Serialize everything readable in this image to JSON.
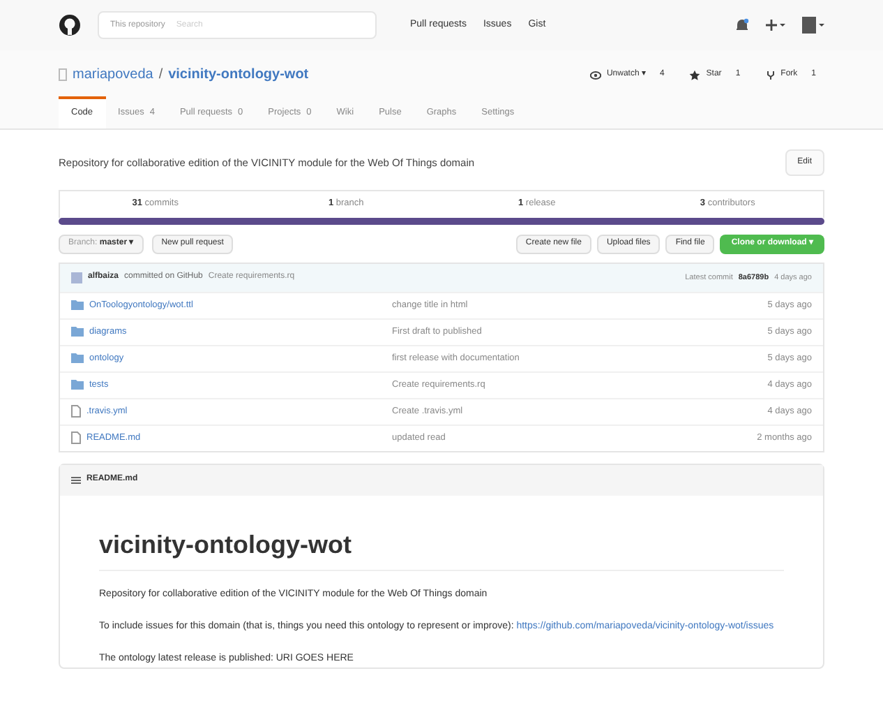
{
  "header": {
    "scope": "This repository",
    "search_placeholder": "Search",
    "nav": [
      "Pull requests",
      "Issues",
      "Gist"
    ]
  },
  "repo": {
    "owner": "mariapoveda",
    "separator": "/",
    "name": "vicinity-ontology-wot",
    "actions": [
      {
        "label": "Unwatch ▾",
        "count": "4",
        "kind": "watch"
      },
      {
        "label": "Star",
        "count": "1",
        "kind": "star"
      },
      {
        "label": "Fork",
        "count": "1",
        "kind": "fork"
      }
    ]
  },
  "tabs": [
    {
      "label": "Code",
      "selected": true
    },
    {
      "label": "Issues",
      "count": "4",
      "selected": false
    },
    {
      "label": "Pull requests",
      "count": "0",
      "selected": false
    },
    {
      "label": "Projects",
      "count": "0",
      "selected": false
    },
    {
      "label": "Wiki",
      "selected": false
    },
    {
      "label": "Pulse",
      "selected": false
    },
    {
      "label": "Graphs",
      "selected": false
    },
    {
      "label": "Settings",
      "selected": false
    }
  ],
  "description": "Repository for collaborative edition of the VICINITY module for the Web Of Things domain",
  "edit_button": "Edit",
  "stats": [
    {
      "number": "31",
      "label": "commits"
    },
    {
      "number": "1",
      "label": "branch"
    },
    {
      "number": "1",
      "label": "release"
    },
    {
      "number": "3",
      "label": "contributors"
    }
  ],
  "toolbar": {
    "branch_label": "Branch:",
    "branch": "master ▾",
    "new_pr": "New pull request",
    "buttons": [
      "Create new file",
      "Upload files",
      "Find file"
    ],
    "clone": "Clone or download ▾"
  },
  "commit": {
    "author": "alfbaiza",
    "text": "committed on GitHub",
    "message": "Create requirements.rq",
    "latest": "Latest commit",
    "hash": "8a6789b",
    "age": "4 days ago"
  },
  "files": [
    {
      "kind": "folder",
      "name": "OnToologyontology/wot.ttl",
      "message": "change title in html",
      "age": "5 days ago"
    },
    {
      "kind": "folder",
      "name": "diagrams",
      "message": "First draft to published",
      "age": "5 days ago"
    },
    {
      "kind": "folder",
      "name": "ontology",
      "message": "first release with documentation",
      "age": "5 days ago"
    },
    {
      "kind": "folder",
      "name": "tests",
      "message": "Create requirements.rq",
      "age": "4 days ago"
    },
    {
      "kind": "file",
      "name": ".travis.yml",
      "message": "Create .travis.yml",
      "age": "4 days ago"
    },
    {
      "kind": "file",
      "name": "README.md",
      "message": "updated read",
      "age": "2 months ago"
    }
  ],
  "readme": {
    "file": "README.md",
    "title": "vicinity-ontology-wot",
    "paragraphs": [
      {
        "text": "Repository for collaborative edition of the VICINITY module for the Web Of Things domain"
      },
      {
        "text": "To include issues for this domain (that is, things you need this ontology to represent or improve):",
        "link": "https://github.com/mariapoveda/vicinity-ontology-wot/issues"
      },
      {
        "text": "The ontology latest release is published: URI GOES HERE"
      }
    ]
  }
}
